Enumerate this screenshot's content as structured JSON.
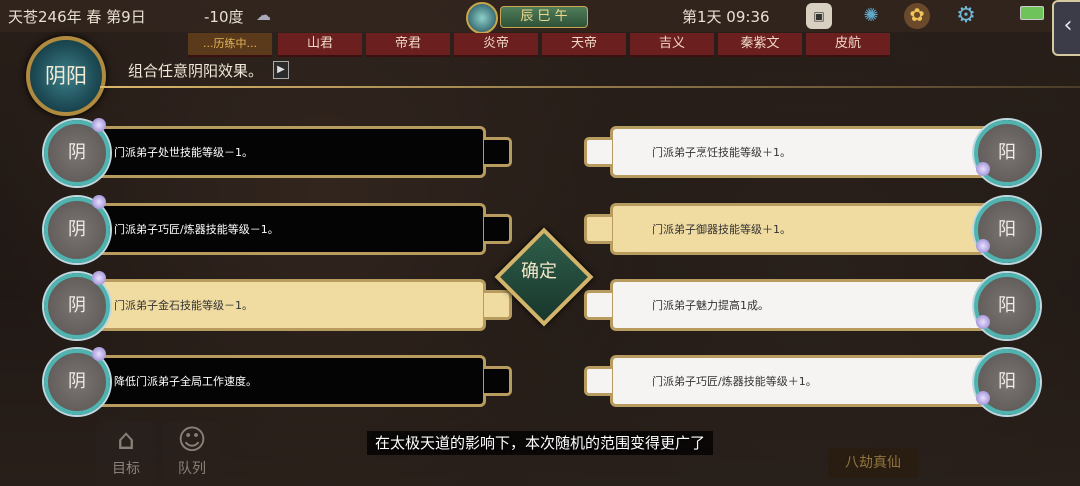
{
  "status_bar": {
    "date": "天苍246年 春 第9日",
    "temperature": "-10度",
    "shichen": "辰 巳 午",
    "day_time": "第1天 09:36"
  },
  "tabs": [
    "...历练中...",
    "山君",
    "帝君",
    "炎帝",
    "天帝",
    "吉义",
    "秦紫文",
    "皮航"
  ],
  "header": {
    "emblem": "阴阳",
    "description": "组合任意阴阳效果。"
  },
  "yin_effects": [
    {
      "symbol": "阴",
      "text": "门派弟子处世技能等级－1。",
      "style": "black"
    },
    {
      "symbol": "阴",
      "text": "门派弟子巧匠/炼器技能等级－1。",
      "style": "black"
    },
    {
      "symbol": "阴",
      "text": "门派弟子金石技能等级－1。",
      "style": "gold"
    },
    {
      "symbol": "阴",
      "text": "降低门派弟子全局工作速度。",
      "style": "black"
    }
  ],
  "yang_effects": [
    {
      "symbol": "阳",
      "text": "门派弟子烹饪技能等级＋1。",
      "style": "white"
    },
    {
      "symbol": "阳",
      "text": "门派弟子御器技能等级＋1。",
      "style": "gold"
    },
    {
      "symbol": "阳",
      "text": "门派弟子魅力提高1成。",
      "style": "white"
    },
    {
      "symbol": "阳",
      "text": "门派弟子巧匠/炼器技能等级＋1。",
      "style": "white"
    }
  ],
  "confirm_label": "确定",
  "subtitle": "在太极天道的影响下，本次随机的范围变得更广了",
  "bottom": {
    "goal": "目标",
    "queue": "队列",
    "immortal": "八劫真仙"
  },
  "colors": {
    "bar_border": "#b89b5e",
    "disc_ring": "#4fb3b0",
    "tab_red": "#6b1f1f",
    "gold_fill": "#f0dba1"
  }
}
